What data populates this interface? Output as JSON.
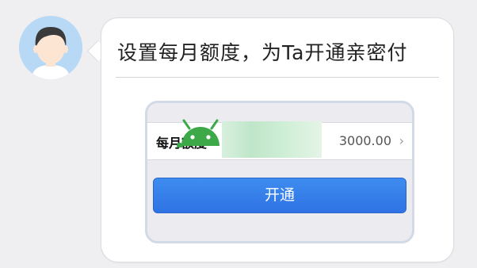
{
  "message": {
    "title": "设置每月额度，为Ta开通亲密付"
  },
  "preview": {
    "row_label": "每月额度",
    "amount": "3000.00",
    "chevron": "›",
    "button_label": "开通"
  },
  "colors": {
    "page_bg": "#efeff2",
    "button_blue": "#3a84ee",
    "android_green": "#3ca848"
  },
  "icons": [
    "user-avatar",
    "android-icon",
    "chevron-right-icon"
  ]
}
